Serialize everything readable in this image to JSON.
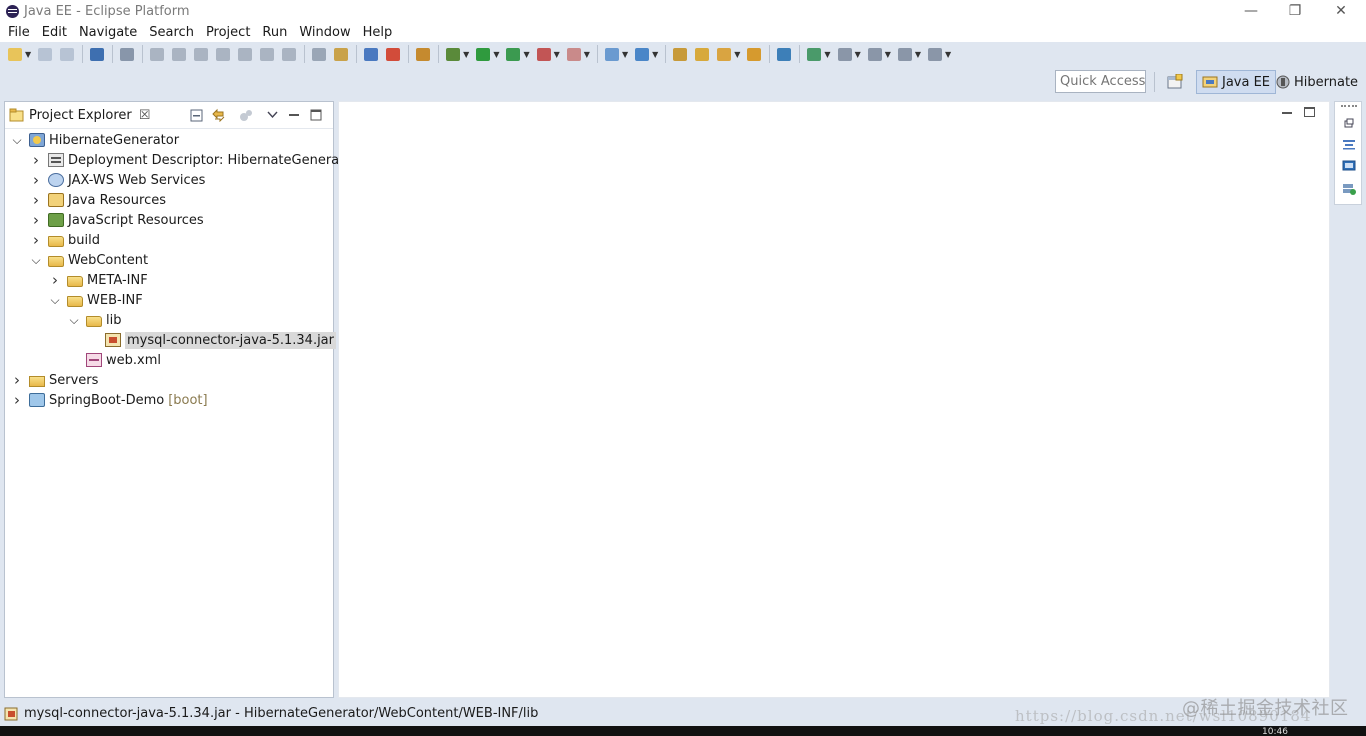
{
  "window": {
    "title": "Java EE - Eclipse Platform",
    "minimize_glyph": "—",
    "restore_glyph": "❐",
    "close_glyph": "✕"
  },
  "menu": [
    "File",
    "Edit",
    "Navigate",
    "Search",
    "Project",
    "Run",
    "Window",
    "Help"
  ],
  "toolbar": {
    "buttons": [
      {
        "icon": "new-wizard-icon",
        "color": "#e8c45a",
        "dropdown": true
      },
      {
        "icon": "save-icon",
        "color": "#b7c3d4"
      },
      {
        "icon": "save-all-icon",
        "color": "#b7c3d4"
      },
      "sep",
      {
        "icon": "terminal-icon",
        "color": "#3e6fb0"
      },
      "sep",
      {
        "icon": "skip-breakpoints-icon",
        "color": "#8896aa"
      },
      "sep",
      {
        "icon": "resume-icon",
        "color": "#aab4c2"
      },
      {
        "icon": "suspend-icon",
        "color": "#aab4c2"
      },
      {
        "icon": "terminate-icon",
        "color": "#aab4c2"
      },
      {
        "icon": "disconnect-icon",
        "color": "#aab4c2"
      },
      {
        "icon": "step-into-icon",
        "color": "#aab4c2"
      },
      {
        "icon": "step-over-icon",
        "color": "#aab4c2"
      },
      {
        "icon": "step-return-icon",
        "color": "#aab4c2"
      },
      "sep",
      {
        "icon": "use-step-filters-icon",
        "color": "#9aa6b6"
      },
      {
        "icon": "drop-to-frame-icon",
        "color": "#c9a24a"
      },
      "sep",
      {
        "icon": "toggle-mark-occurrences-icon",
        "color": "#4a79c0"
      },
      {
        "icon": "open-browser-icon",
        "color": "#d24c3a"
      },
      "sep",
      {
        "icon": "open-task-icon",
        "color": "#c58a2f"
      },
      "sep",
      {
        "icon": "debug-icon",
        "color": "#5a8a3a",
        "dropdown": true
      },
      {
        "icon": "run-icon",
        "color": "#2f9a3e",
        "dropdown": true
      },
      {
        "icon": "coverage-icon",
        "color": "#3b9a50",
        "dropdown": true
      },
      {
        "icon": "external-tools-icon",
        "color": "#c25555",
        "dropdown": true
      },
      {
        "icon": "server-icon",
        "color": "#c98a8a",
        "dropdown": true
      },
      "sep",
      {
        "icon": "new-java-project-icon",
        "color": "#6a9ad0",
        "dropdown": true
      },
      {
        "icon": "new-class-icon",
        "color": "#4a86c8",
        "dropdown": true
      },
      "sep",
      {
        "icon": "open-type-icon",
        "color": "#c79a3a"
      },
      {
        "icon": "open-folder-icon",
        "color": "#d7a93c"
      },
      {
        "icon": "search-icon",
        "color": "#d9a441",
        "dropdown": true
      },
      {
        "icon": "open-resource-icon",
        "color": "#d69a2e"
      },
      "sep",
      {
        "icon": "globe-icon",
        "color": "#3d7fb8"
      },
      "sep",
      {
        "icon": "annotation-icon",
        "color": "#4a9a6a",
        "dropdown": true
      },
      {
        "icon": "next-annotation-icon",
        "color": "#8a96a8",
        "dropdown": true
      },
      {
        "icon": "previous-edit-icon",
        "color": "#8a96a8",
        "dropdown": true
      },
      {
        "icon": "back-icon",
        "color": "#8a96a8",
        "dropdown": true
      },
      {
        "icon": "forward-icon",
        "color": "#8a96a8",
        "dropdown": true
      }
    ]
  },
  "perspective_bar": {
    "quick_access_placeholder": "Quick Access",
    "perspectives": [
      {
        "label": "Java EE",
        "icon": "java-ee-perspective-icon",
        "active": true
      },
      {
        "label": "Hibernate",
        "icon": "hibernate-perspective-icon",
        "active": false
      }
    ]
  },
  "project_explorer": {
    "tab_label": "Project Explorer",
    "close_glyph": "☒",
    "tree": [
      {
        "label": "HibernateGenerator",
        "depth": 0,
        "expanded": true,
        "icon": "project"
      },
      {
        "label": "Deployment Descriptor: HibernateGenerator",
        "depth": 1,
        "expanded": false,
        "icon": "dd"
      },
      {
        "label": "JAX-WS Web Services",
        "depth": 1,
        "expanded": false,
        "icon": "ws"
      },
      {
        "label": "Java Resources",
        "depth": 1,
        "expanded": false,
        "icon": "java"
      },
      {
        "label": "JavaScript Resources",
        "depth": 1,
        "expanded": false,
        "icon": "js"
      },
      {
        "label": "build",
        "depth": 1,
        "expanded": false,
        "icon": "folder"
      },
      {
        "label": "WebContent",
        "depth": 1,
        "expanded": true,
        "icon": "folder"
      },
      {
        "label": "META-INF",
        "depth": 2,
        "expanded": false,
        "icon": "folder"
      },
      {
        "label": "WEB-INF",
        "depth": 2,
        "expanded": true,
        "icon": "folder"
      },
      {
        "label": "lib",
        "depth": 3,
        "expanded": true,
        "icon": "folder"
      },
      {
        "label": "mysql-connector-java-5.1.34.jar",
        "depth": 4,
        "leaf": true,
        "icon": "jar",
        "selected": true
      },
      {
        "label": "web.xml",
        "depth": 3,
        "leaf": true,
        "icon": "xml"
      },
      {
        "label": "Servers",
        "depth": 0,
        "expanded": false,
        "icon": "servers"
      },
      {
        "label": "SpringBoot-Demo",
        "decoration": "[boot]",
        "depth": 0,
        "expanded": false,
        "icon": "boot"
      }
    ]
  },
  "status_bar": {
    "text": "mysql-connector-java-5.1.34.jar - HibernateGenerator/WebContent/WEB-INF/lib"
  },
  "watermark": {
    "cn": "@稀土掘金技术社区",
    "url": "https://blog.csdn.net/wsl10890184"
  },
  "taskbar": {
    "clock": "10:46"
  }
}
